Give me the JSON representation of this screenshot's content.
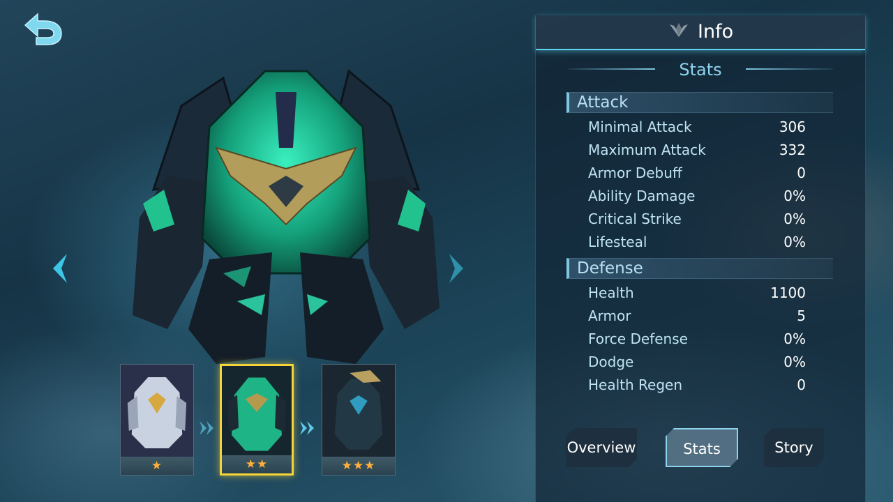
{
  "panel": {
    "title": "Info",
    "subtitle": "Stats"
  },
  "attack": {
    "heading": "Attack",
    "stats": [
      {
        "label": "Minimal Attack",
        "value": "306"
      },
      {
        "label": "Maximum Attack",
        "value": "332"
      },
      {
        "label": "Armor Debuff",
        "value": "0"
      },
      {
        "label": "Ability Damage",
        "value": "0%"
      },
      {
        "label": "Critical Strike",
        "value": "0%"
      },
      {
        "label": "Lifesteal",
        "value": "0%"
      }
    ]
  },
  "defense": {
    "heading": "Defense",
    "stats": [
      {
        "label": "Health",
        "value": "1100"
      },
      {
        "label": "Armor",
        "value": "5"
      },
      {
        "label": "Force Defense",
        "value": "0%"
      },
      {
        "label": "Dodge",
        "value": "0%"
      },
      {
        "label": "Health Regen",
        "value": "0"
      }
    ]
  },
  "tabs": {
    "overview": "Overview",
    "stats": "Stats",
    "story": "Story"
  },
  "evolutions": [
    {
      "stars": "★",
      "star_count": 1
    },
    {
      "stars": "★★",
      "star_count": 2,
      "selected": true
    },
    {
      "stars": "★★★",
      "star_count": 3
    }
  ],
  "colors": {
    "accent": "#5fd4f0",
    "selected_border": "#f5d43a",
    "star": "#ffb03a",
    "hero_glow": "#2ee0b0"
  },
  "icons": {
    "back": "back-arrow-icon",
    "info": "wings-emblem-icon",
    "nav_prev": "chevron-left-icon",
    "nav_next": "chevron-right-icon",
    "evolve": "double-chevron-right-icon"
  }
}
